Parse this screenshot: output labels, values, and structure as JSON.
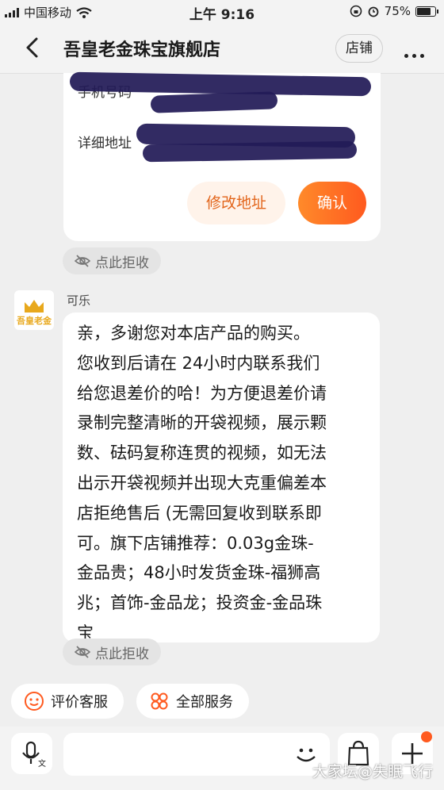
{
  "status_bar": {
    "carrier": "中国移动",
    "time": "上午 9:16",
    "battery": "75%"
  },
  "header": {
    "title": "吾皇老金珠宝旗舰店",
    "shop_button": "店铺"
  },
  "address_card": {
    "phone_label": "手机号码",
    "address_label": "详细地址",
    "edit_button": "修改地址",
    "confirm_button": "确认"
  },
  "reject_label": "点此拒收",
  "message": {
    "sender": "可乐",
    "avatar_text": "吾皇老金",
    "text": "亲，多谢您对本店产品的购买。\n您收到后请在 24小时内联系我们\n给您退差价的哈！为方便退差价请\n录制完整清晰的开袋视频，展示颗\n数、砝码复称连贯的视频，如无法\n出示开袋视频并出现大克重偏差本\n店拒绝售后 (无需回复收到联系即\n可。旗下店铺推荐：0.03g金珠-\n金品贵；48小时发货金珠-福狮高\n兆；首饰-金品龙；投资金-金品珠\n宝"
  },
  "quick_actions": {
    "rate_service": "评价客服",
    "all_services": "全部服务"
  },
  "watermark": "大家坛@失眠飞行",
  "colors": {
    "accent": "#ff5a1f",
    "accent_light": "#fff3ea",
    "redaction": "#221b57",
    "avatar_gold": "#e8a81c"
  }
}
